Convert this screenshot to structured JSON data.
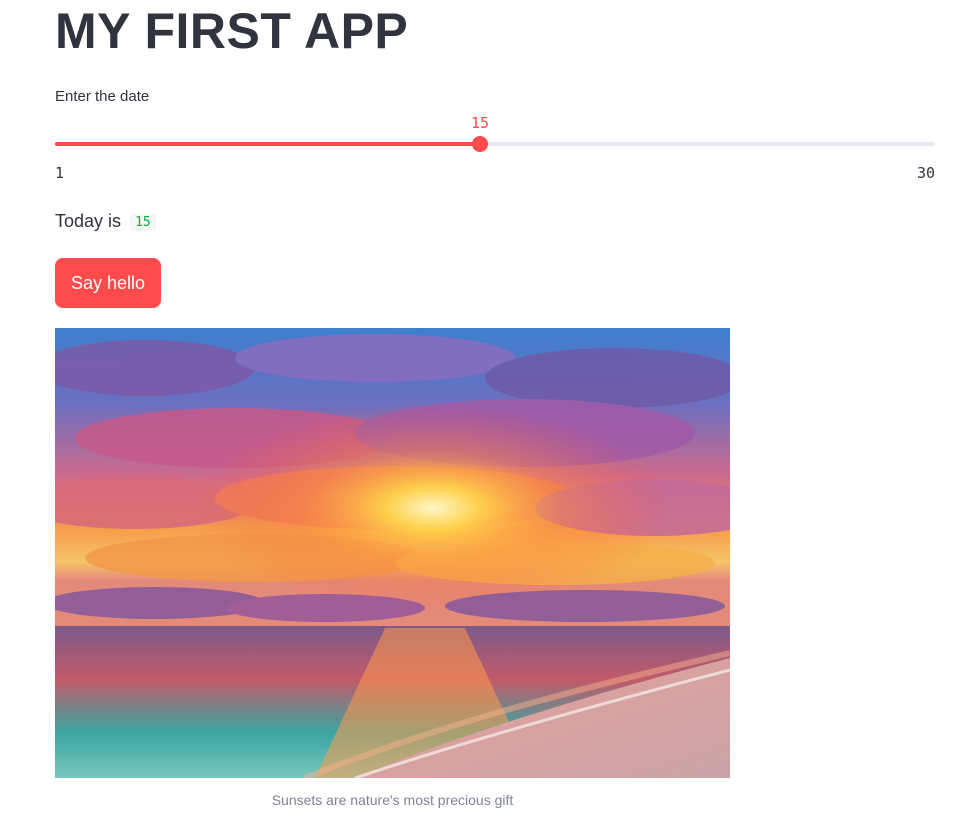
{
  "app": {
    "title": "MY FIRST APP"
  },
  "slider": {
    "label": "Enter the date",
    "min": 1,
    "max": 30,
    "value": 15,
    "min_label": "1",
    "max_label": "30",
    "value_label": "15",
    "accent_color": "#ff4b4b"
  },
  "output": {
    "prefix": "Today is",
    "value": "15"
  },
  "button": {
    "label": "Say hello"
  },
  "image": {
    "caption": "Sunsets are nature's most precious gift"
  }
}
